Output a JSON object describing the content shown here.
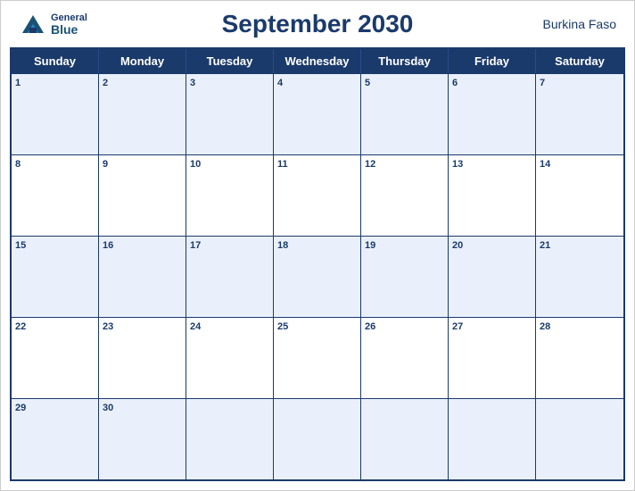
{
  "header": {
    "title": "September 2030",
    "country": "Burkina Faso",
    "logo_general": "General",
    "logo_blue": "Blue"
  },
  "days_of_week": [
    "Sunday",
    "Monday",
    "Tuesday",
    "Wednesday",
    "Thursday",
    "Friday",
    "Saturday"
  ],
  "weeks": [
    [
      {
        "date": "1",
        "empty": false
      },
      {
        "date": "2",
        "empty": false
      },
      {
        "date": "3",
        "empty": false
      },
      {
        "date": "4",
        "empty": false
      },
      {
        "date": "5",
        "empty": false
      },
      {
        "date": "6",
        "empty": false
      },
      {
        "date": "7",
        "empty": false
      }
    ],
    [
      {
        "date": "8",
        "empty": false
      },
      {
        "date": "9",
        "empty": false
      },
      {
        "date": "10",
        "empty": false
      },
      {
        "date": "11",
        "empty": false
      },
      {
        "date": "12",
        "empty": false
      },
      {
        "date": "13",
        "empty": false
      },
      {
        "date": "14",
        "empty": false
      }
    ],
    [
      {
        "date": "15",
        "empty": false
      },
      {
        "date": "16",
        "empty": false
      },
      {
        "date": "17",
        "empty": false
      },
      {
        "date": "18",
        "empty": false
      },
      {
        "date": "19",
        "empty": false
      },
      {
        "date": "20",
        "empty": false
      },
      {
        "date": "21",
        "empty": false
      }
    ],
    [
      {
        "date": "22",
        "empty": false
      },
      {
        "date": "23",
        "empty": false
      },
      {
        "date": "24",
        "empty": false
      },
      {
        "date": "25",
        "empty": false
      },
      {
        "date": "26",
        "empty": false
      },
      {
        "date": "27",
        "empty": false
      },
      {
        "date": "28",
        "empty": false
      }
    ],
    [
      {
        "date": "29",
        "empty": false
      },
      {
        "date": "30",
        "empty": false
      },
      {
        "date": "",
        "empty": true
      },
      {
        "date": "",
        "empty": true
      },
      {
        "date": "",
        "empty": true
      },
      {
        "date": "",
        "empty": true
      },
      {
        "date": "",
        "empty": true
      }
    ]
  ],
  "colors": {
    "header_bg": "#1a3a6b",
    "header_text": "#ffffff",
    "title_color": "#1a3a6b",
    "alt_row_bg": "#eaf0fb",
    "white": "#ffffff"
  }
}
